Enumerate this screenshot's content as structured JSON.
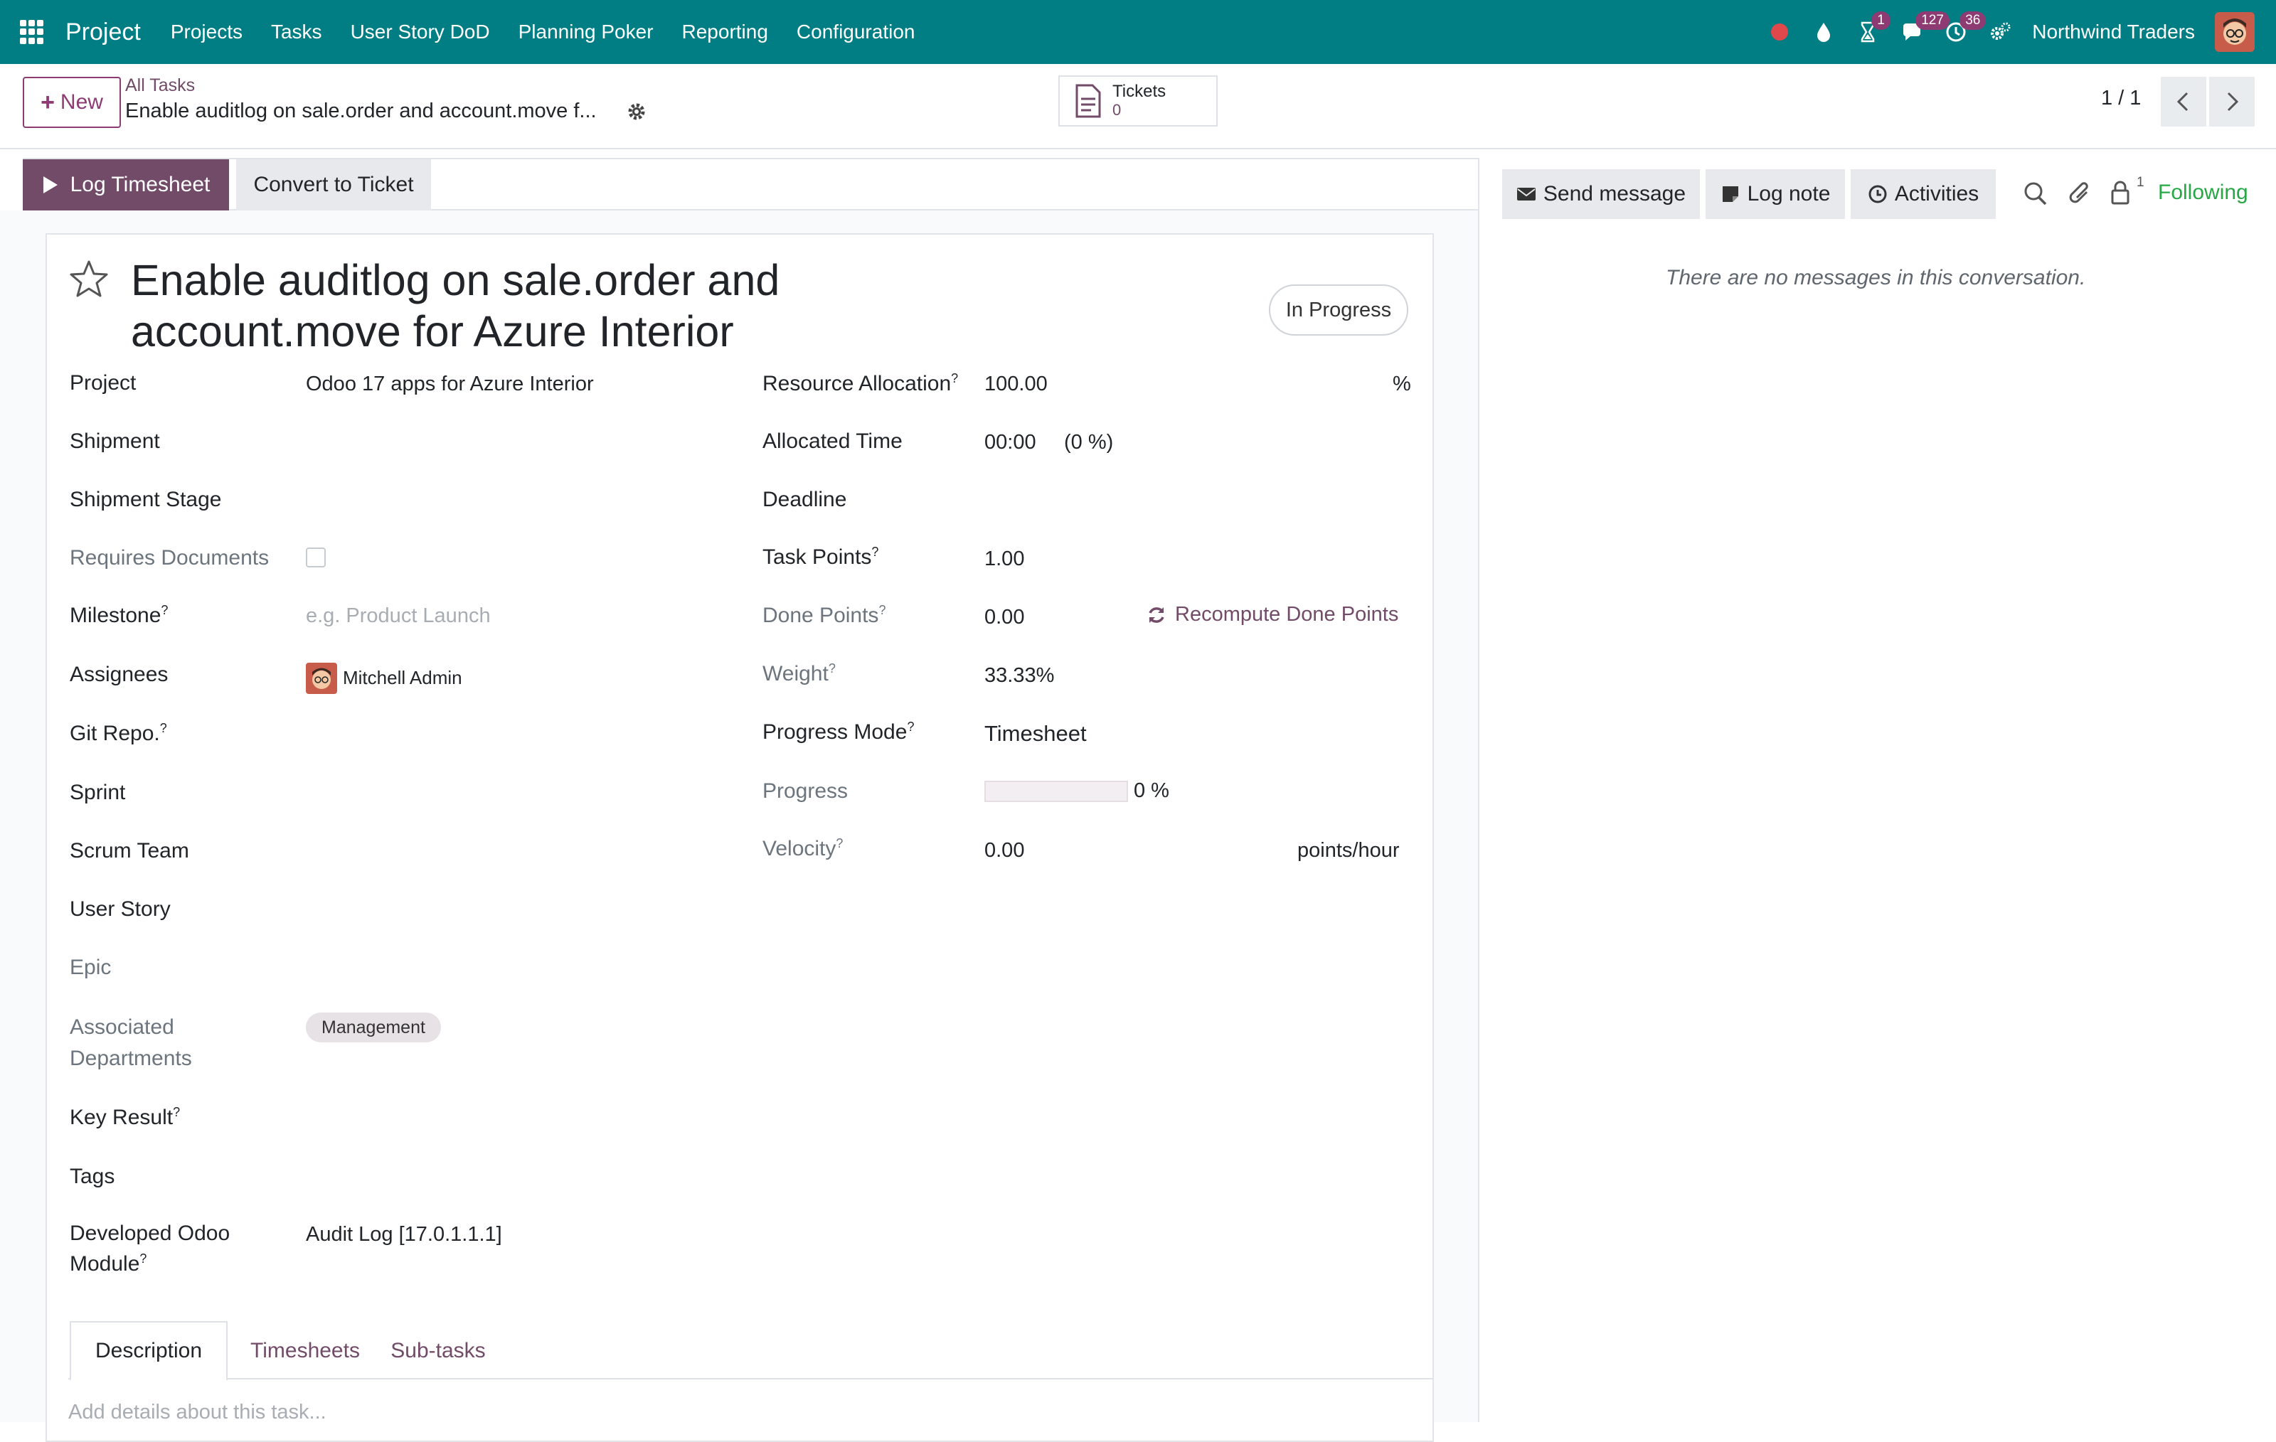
{
  "navbar": {
    "brand": "Project",
    "menu": [
      "Projects",
      "Tasks",
      "User Story DoD",
      "Planning Poker",
      "Reporting",
      "Configuration"
    ],
    "badges": {
      "activities": "1",
      "messages": "127",
      "timer": "36"
    },
    "company": "Northwind Traders"
  },
  "control": {
    "new_label": "New",
    "breadcrumb_parent": "All Tasks",
    "breadcrumb_current": "Enable auditlog on sale.order and account.move f...",
    "stat_label": "Tickets",
    "stat_value": "0",
    "pager": "1 / 1"
  },
  "statusbar": {
    "log_timesheet": "Log Timesheet",
    "convert_ticket": "Convert to Ticket"
  },
  "task": {
    "title": "Enable auditlog on sale.order and account.move for Azure Interior",
    "stage": "In Progress"
  },
  "left_fields": {
    "project_label": "Project",
    "project_value": "Odoo 17 apps for Azure Interior",
    "shipment_label": "Shipment",
    "shipment_stage_label": "Shipment Stage",
    "requires_documents_label": "Requires Documents",
    "milestone_label": "Milestone",
    "milestone_placeholder": "e.g. Product Launch",
    "assignees_label": "Assignees",
    "assignee_name": "Mitchell Admin",
    "git_repo_label": "Git Repo.",
    "sprint_label": "Sprint",
    "scrum_team_label": "Scrum Team",
    "user_story_label": "User Story",
    "epic_label": "Epic",
    "associated_label_1": "Associated",
    "associated_label_2": "Departments",
    "department_tag": "Management",
    "key_result_label": "Key Result",
    "tags_label": "Tags",
    "developed_label_1": "Developed Odoo",
    "developed_label_2": "Module",
    "developed_value": "Audit Log [17.0.1.1.1]"
  },
  "right_fields": {
    "resource_allocation_label": "Resource Allocation",
    "resource_allocation_value": "100.00",
    "resource_allocation_unit": "%",
    "allocated_time_label": "Allocated Time",
    "allocated_time_value": "00:00",
    "allocated_time_pct": "(0 %)",
    "deadline_label": "Deadline",
    "task_points_label": "Task Points",
    "task_points_value": "1.00",
    "done_points_label": "Done Points",
    "done_points_value": "0.00",
    "recompute_label": "Recompute Done Points",
    "weight_label": "Weight",
    "weight_value": "33.33%",
    "progress_mode_label": "Progress Mode",
    "progress_mode_value": "Timesheet",
    "progress_label": "Progress",
    "progress_value": 0,
    "progress_text": "0 %",
    "velocity_label": "Velocity",
    "velocity_value": "0.00",
    "velocity_unit": "points/hour"
  },
  "help_mark": "?",
  "tabs": [
    "Description",
    "Timesheets",
    "Sub-tasks"
  ],
  "description_placeholder": "Add details about this task...",
  "chatter": {
    "send_message": "Send message",
    "log_note": "Log note",
    "activities": "Activities",
    "follower_count": "1",
    "following": "Following",
    "empty": "There are no messages in this conversation."
  },
  "colors": {
    "navbar": "#017e84",
    "primary": "#714b67",
    "badge": "#8d3b72",
    "following": "#28a745"
  }
}
